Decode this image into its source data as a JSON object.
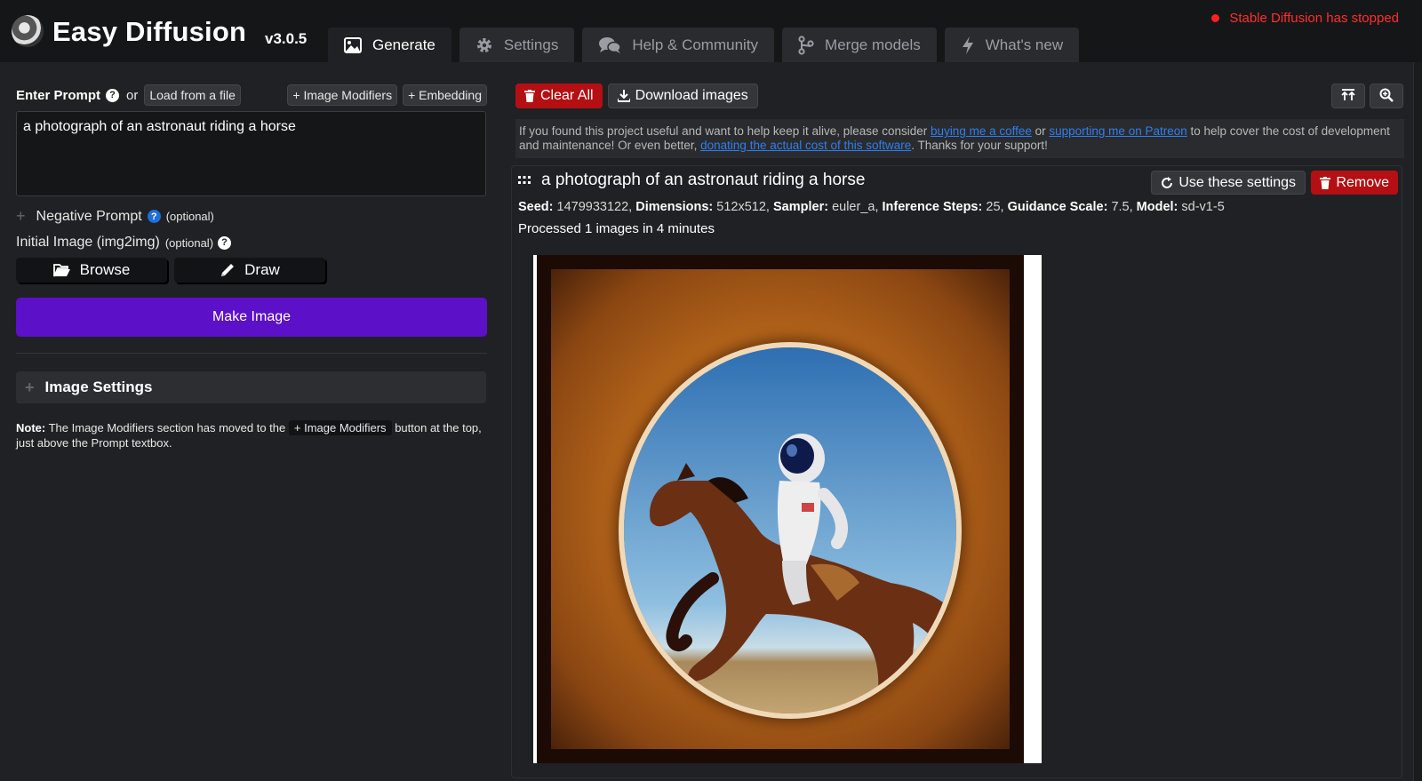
{
  "app": {
    "title": "Easy Diffusion",
    "version": "v3.0.5",
    "status": "Stable Diffusion has stopped"
  },
  "tabs": [
    {
      "label": "Generate",
      "icon": "image-icon"
    },
    {
      "label": "Settings",
      "icon": "gear-icon"
    },
    {
      "label": "Help & Community",
      "icon": "comments-icon"
    },
    {
      "label": "Merge models",
      "icon": "branch-icon"
    },
    {
      "label": "What's new",
      "icon": "bolt-icon"
    }
  ],
  "left": {
    "prompt_label": "Enter Prompt",
    "or": "or",
    "load_from_file": "Load from a file",
    "image_modifiers": "+ Image Modifiers",
    "embedding": "+ Embedding",
    "prompt_value": "a photograph of an astronaut riding a horse",
    "negative_label": "Negative Prompt",
    "optional": "(optional)",
    "initial_image_label": "Initial Image (img2img)",
    "browse": "Browse",
    "draw": "Draw",
    "make_image": "Make Image",
    "image_settings": "Image Settings",
    "note_bold": "Note:",
    "note_text_1": "The Image Modifiers section has moved to the",
    "note_chip": "+ Image Modifiers",
    "note_text_2": "button at the top, just above the Prompt textbox."
  },
  "right": {
    "clear_all": "Clear All",
    "download_images": "Download images",
    "support": {
      "t1": "If you found this project useful and want to help keep it alive, please consider ",
      "link1": "buying me a coffee",
      "t2": " or ",
      "link2": "supporting me on Patreon",
      "t3": " to help cover the cost of development and maintenance! Or even better, ",
      "link3": "donating the actual cost of this software",
      "t4": ". Thanks for your support!"
    },
    "result": {
      "title": "a photograph of an astronaut riding a horse",
      "use_settings": "Use these settings",
      "remove": "Remove",
      "seed_label": "Seed:",
      "seed": "1479933122,",
      "dim_label": "Dimensions:",
      "dim": "512x512,",
      "sampler_label": "Sampler:",
      "sampler": "euler_a,",
      "steps_label": "Inference Steps:",
      "steps": "25,",
      "guidance_label": "Guidance Scale:",
      "guidance": "7.5,",
      "model_label": "Model:",
      "model": "sd-v1-5",
      "processed": "Processed 1 images in 4 minutes"
    }
  },
  "colors": {
    "accent": "#5c10c8",
    "danger": "#b40f13",
    "status": "#ff2e2e",
    "link": "#2e7ff0"
  }
}
